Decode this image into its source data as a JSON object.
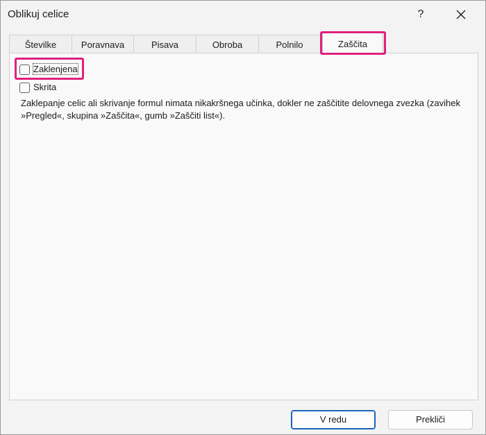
{
  "dialog": {
    "title": "Oblikuj celice",
    "help_label": "?"
  },
  "tabs": [
    {
      "label": "Številke"
    },
    {
      "label": "Poravnava"
    },
    {
      "label": "Pisava"
    },
    {
      "label": "Obroba"
    },
    {
      "label": "Polnilo"
    },
    {
      "label": "Zaščita",
      "active": true
    }
  ],
  "protection": {
    "locked": {
      "label": "Zaklenjena",
      "checked": false
    },
    "hidden": {
      "label": "Skrita",
      "checked": false
    },
    "description": "Zaklepanje celic ali skrivanje formul nimata nikakršnega učinka, dokler ne zaščitite delovnega zvezka (zavihek »Pregled«, skupina »Zaščita«, gumb »Zaščiti list«)."
  },
  "buttons": {
    "ok_label": "V redu",
    "cancel_label": "Prekliči"
  },
  "colors": {
    "highlight": "#e0207d",
    "primary_button_border": "#1a64b8"
  }
}
